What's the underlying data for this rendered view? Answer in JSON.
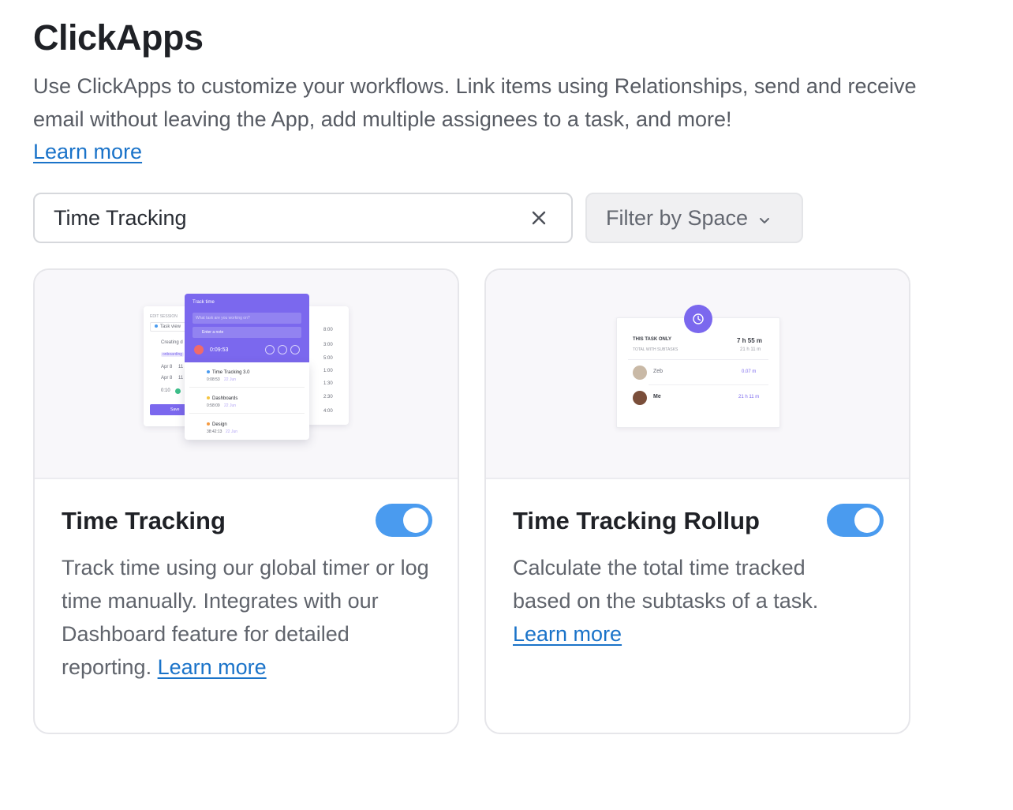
{
  "header": {
    "title": "ClickApps",
    "description": "Use ClickApps to customize your workflows. Link items using Relationships, send and receive email without leaving the App, add multiple assignees to a task, and more!",
    "learn_more": "Learn more"
  },
  "search": {
    "value": "Time Tracking",
    "clear_icon": "close-icon"
  },
  "filter": {
    "label": "Filter by Space",
    "icon": "chevron-down-icon"
  },
  "cards": [
    {
      "title": "Time Tracking",
      "description": "Track time using our global timer or log time manually. Integrates with our Dashboard feature for detailed reporting.",
      "learn_more": "Learn more",
      "enabled": true,
      "illustration": {
        "edit_session": "EDIT SESSION",
        "task_view": "Task view",
        "creating": "Creating d",
        "tag": "onboarding",
        "date1": "Apr 8",
        "date1_suffix": "11",
        "date2": "Apr 8",
        "date2_suffix": "11",
        "duration": "0:10",
        "save": "Save",
        "track_time": "Track time",
        "task_placeholder": "What task are you working on?",
        "note": "Enter a note",
        "timer": "0:09:53",
        "entries": [
          {
            "name": "Time Tracking 3.0",
            "time": "0:08:53",
            "date": "22 Jun",
            "color": "#4a9bef"
          },
          {
            "name": "Dashboards",
            "time": "0:58:09",
            "date": "22 Jun",
            "color": "#f5c542"
          },
          {
            "name": "Design",
            "time": "38:42:13",
            "date": "22 Jun",
            "color": "#f59b42"
          }
        ],
        "times": [
          "8:00",
          "3:00",
          "5:00",
          "1:00",
          "1:30",
          "2:30",
          "4:00"
        ]
      }
    },
    {
      "title": "Time Tracking Rollup",
      "description": "Calculate the total time tracked based on the subtasks of a task.",
      "learn_more": "Learn more",
      "enabled": true,
      "illustration": {
        "this_task_only": "THIS TASK ONLY",
        "this_task_value": "7 h 55 m",
        "total_with_subtasks": "TOTAL WITH SUBTASKS",
        "total_value": "21 h 11 m",
        "rows": [
          {
            "name": "Zeb",
            "value": "0.07 m"
          },
          {
            "name": "Me",
            "value": "21 h 11 m"
          }
        ]
      }
    }
  ],
  "colors": {
    "accent": "#7b68ee",
    "toggle_on": "#4a9bef",
    "link": "#1a73c9"
  }
}
